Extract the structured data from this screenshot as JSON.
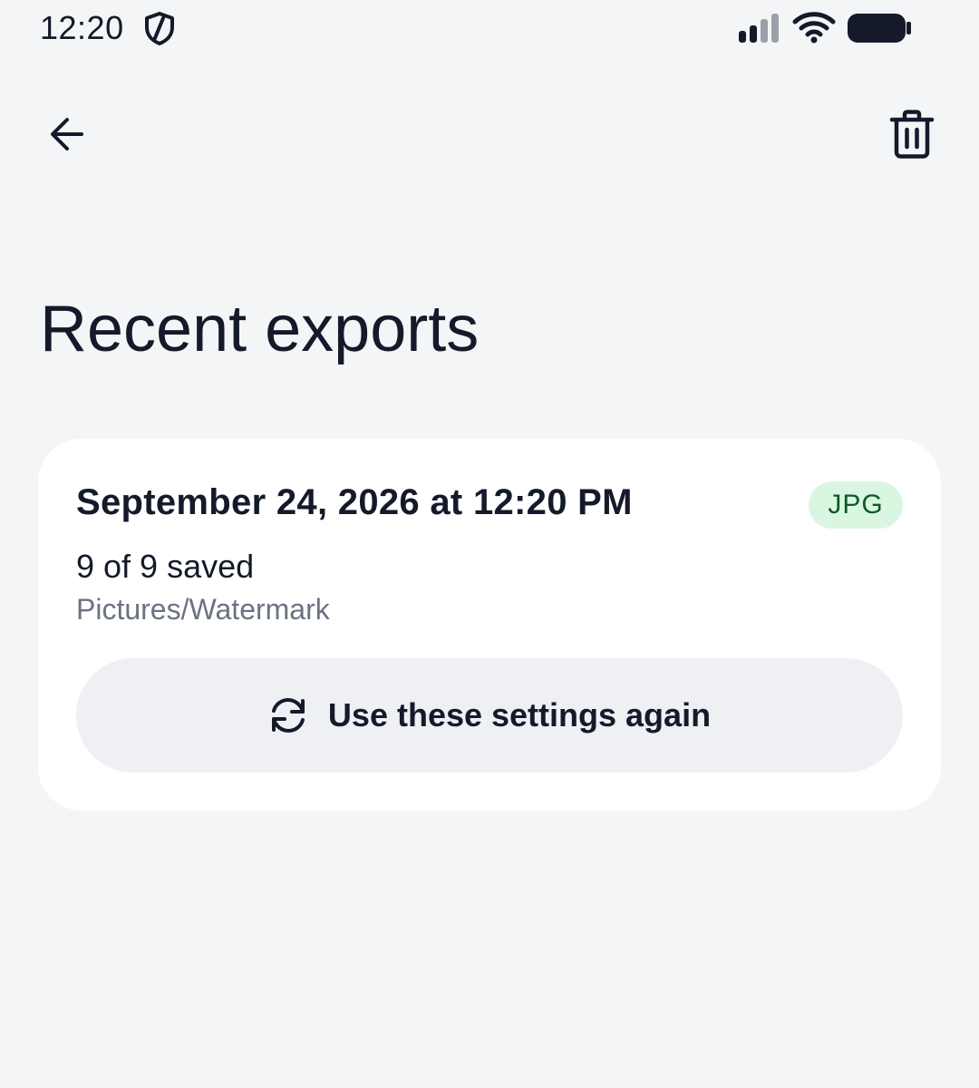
{
  "status_bar": {
    "time": "12:20"
  },
  "top_bar": {
    "back_icon": "arrow-left-icon",
    "delete_icon": "trash-icon"
  },
  "page": {
    "title": "Recent exports"
  },
  "exports": [
    {
      "date": "September 24, 2026 at 12:20 PM",
      "format": "JPG",
      "saved": "9 of 9 saved",
      "path": "Pictures/Watermark",
      "action_label": "Use these settings again",
      "action_icon": "refresh-icon"
    }
  ],
  "colors": {
    "background": "#f4f5f7",
    "card": "#ffffff",
    "text": "#141a2a",
    "muted_text": "#6b7283",
    "badge_bg": "#d9f7e0",
    "badge_text": "#0f5a2a",
    "button_bg": "#eef0f4"
  }
}
